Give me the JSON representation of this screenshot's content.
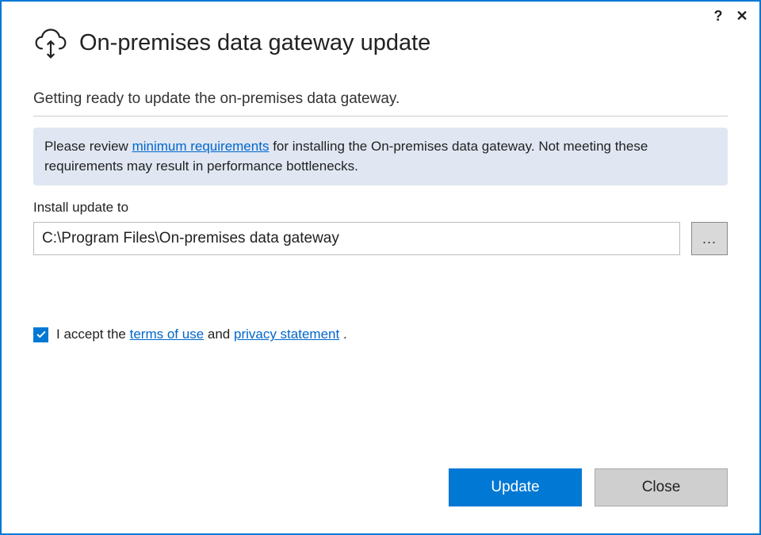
{
  "titlebar": {
    "help_label": "?",
    "close_label": "✕"
  },
  "header": {
    "title": "On-premises data gateway update"
  },
  "main": {
    "subtitle": "Getting ready to update the on-premises data gateway.",
    "notice_prefix": "Please review ",
    "notice_link": "minimum requirements",
    "notice_suffix": " for installing the On-premises data gateway. Not meeting these requirements may result in performance bottlenecks.",
    "install_label": "Install update to",
    "install_path": "C:\\Program Files\\On-premises data gateway",
    "browse_label": "...",
    "accept_prefix": "I accept the ",
    "terms_link": "terms of use",
    "accept_mid": " and ",
    "privacy_link": "privacy statement",
    "accept_suffix": " .",
    "accept_checked": true
  },
  "footer": {
    "update_label": "Update",
    "close_label": "Close"
  }
}
